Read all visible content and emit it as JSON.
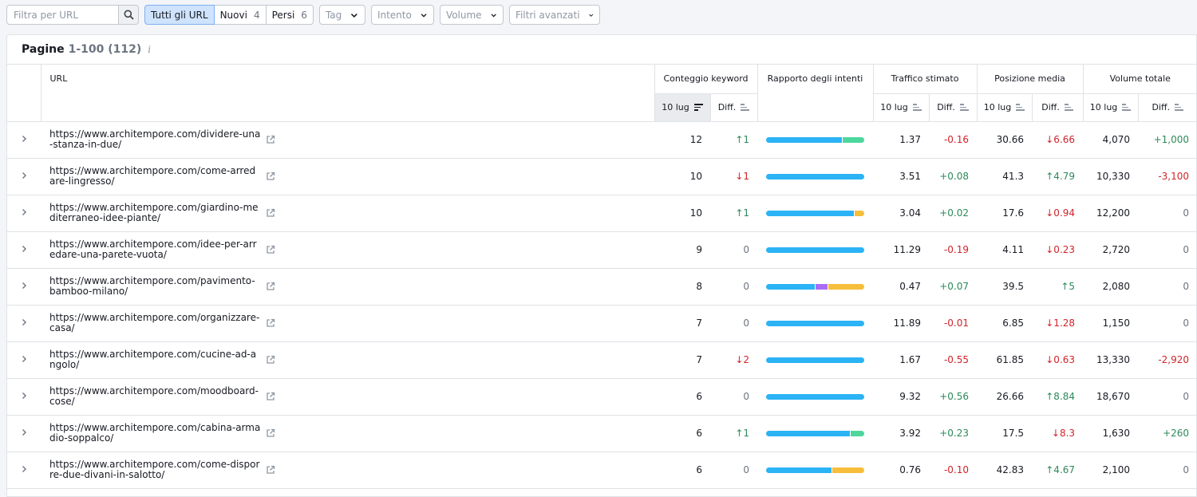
{
  "toolbar": {
    "search_placeholder": "Filtra per URL",
    "seg": [
      {
        "label": "Tutti gli URL",
        "count": ""
      },
      {
        "label": "Nuovi",
        "count": "4"
      },
      {
        "label": "Persi",
        "count": "6"
      }
    ],
    "dropdowns": [
      "Tag",
      "Intento",
      "Volume",
      "Filtri avanzati"
    ]
  },
  "panel": {
    "title": "Pagine",
    "range": "1-100 (112)",
    "info": "i"
  },
  "headers": {
    "url": "URL",
    "keyword_count": "Conteggio keyword",
    "intent_ratio": "Rapporto degli intenti",
    "traffic": "Traffico stimato",
    "position": "Posizione media",
    "volume": "Volume totale",
    "date": "10 lug",
    "diff": "Diff."
  },
  "colors": {
    "informational": "#2bb3f5",
    "navigational": "#a96df6",
    "commercial": "#f7be3b",
    "transactional": "#4dd69d"
  },
  "rows": [
    {
      "url": "https://www.architempore.com/dividere-una-stanza-in-due/",
      "kw": "12",
      "kw_diff": "↑1",
      "kw_dir": "pos",
      "intent": [
        {
          "c": "informational",
          "v": 78
        },
        {
          "c": "transactional",
          "v": 22
        }
      ],
      "traffic": "1.37",
      "traffic_diff": "-0.16",
      "traffic_dir": "neg",
      "pos": "30.66",
      "pos_diff": "↓6.66",
      "pos_dir": "neg",
      "vol": "4,070",
      "vol_diff": "+1,000",
      "vol_dir": "pos"
    },
    {
      "url": "https://www.architempore.com/come-arredare-lingresso/",
      "kw": "10",
      "kw_diff": "↓1",
      "kw_dir": "neg",
      "intent": [
        {
          "c": "informational",
          "v": 100
        }
      ],
      "traffic": "3.51",
      "traffic_diff": "+0.08",
      "traffic_dir": "pos",
      "pos": "41.3",
      "pos_diff": "↑4.79",
      "pos_dir": "pos",
      "vol": "10,330",
      "vol_diff": "-3,100",
      "vol_dir": "neg"
    },
    {
      "url": "https://www.architempore.com/giardino-mediterraneo-idee-piante/",
      "kw": "10",
      "kw_diff": "↑1",
      "kw_dir": "pos",
      "intent": [
        {
          "c": "informational",
          "v": 90
        },
        {
          "c": "commercial",
          "v": 10
        }
      ],
      "traffic": "3.04",
      "traffic_diff": "+0.02",
      "traffic_dir": "pos",
      "pos": "17.6",
      "pos_diff": "↓0.94",
      "pos_dir": "neg",
      "vol": "12,200",
      "vol_diff": "0",
      "vol_dir": "neu"
    },
    {
      "url": "https://www.architempore.com/idee-per-arredare-una-parete-vuota/",
      "kw": "9",
      "kw_diff": "0",
      "kw_dir": "neu",
      "intent": [
        {
          "c": "informational",
          "v": 100
        }
      ],
      "traffic": "11.29",
      "traffic_diff": "-0.19",
      "traffic_dir": "neg",
      "pos": "4.11",
      "pos_diff": "↓0.23",
      "pos_dir": "neg",
      "vol": "2,720",
      "vol_diff": "0",
      "vol_dir": "neu"
    },
    {
      "url": "https://www.architempore.com/pavimento-bamboo-milano/",
      "kw": "8",
      "kw_diff": "0",
      "kw_dir": "neu",
      "intent": [
        {
          "c": "informational",
          "v": 50
        },
        {
          "c": "navigational",
          "v": 13
        },
        {
          "c": "commercial",
          "v": 37
        }
      ],
      "traffic": "0.47",
      "traffic_diff": "+0.07",
      "traffic_dir": "pos",
      "pos": "39.5",
      "pos_diff": "↑5",
      "pos_dir": "pos",
      "vol": "2,080",
      "vol_diff": "0",
      "vol_dir": "neu"
    },
    {
      "url": "https://www.architempore.com/organizzare-casa/",
      "kw": "7",
      "kw_diff": "0",
      "kw_dir": "neu",
      "intent": [
        {
          "c": "informational",
          "v": 100
        }
      ],
      "traffic": "11.89",
      "traffic_diff": "-0.01",
      "traffic_dir": "neg",
      "pos": "6.85",
      "pos_diff": "↓1.28",
      "pos_dir": "neg",
      "vol": "1,150",
      "vol_diff": "0",
      "vol_dir": "neu"
    },
    {
      "url": "https://www.architempore.com/cucine-ad-angolo/",
      "kw": "7",
      "kw_diff": "↓2",
      "kw_dir": "neg",
      "intent": [
        {
          "c": "informational",
          "v": 100
        }
      ],
      "traffic": "1.67",
      "traffic_diff": "-0.55",
      "traffic_dir": "neg",
      "pos": "61.85",
      "pos_diff": "↓0.63",
      "pos_dir": "neg",
      "vol": "13,330",
      "vol_diff": "-2,920",
      "vol_dir": "neg"
    },
    {
      "url": "https://www.architempore.com/moodboard-cose/",
      "kw": "6",
      "kw_diff": "0",
      "kw_dir": "neu",
      "intent": [
        {
          "c": "informational",
          "v": 100
        }
      ],
      "traffic": "9.32",
      "traffic_diff": "+0.56",
      "traffic_dir": "pos",
      "pos": "26.66",
      "pos_diff": "↑8.84",
      "pos_dir": "pos",
      "vol": "18,670",
      "vol_diff": "0",
      "vol_dir": "neu"
    },
    {
      "url": "https://www.architempore.com/cabina-armadio-soppalco/",
      "kw": "6",
      "kw_diff": "↑1",
      "kw_dir": "pos",
      "intent": [
        {
          "c": "informational",
          "v": 86
        },
        {
          "c": "transactional",
          "v": 14
        }
      ],
      "traffic": "3.92",
      "traffic_diff": "+0.23",
      "traffic_dir": "pos",
      "pos": "17.5",
      "pos_diff": "↓8.3",
      "pos_dir": "neg",
      "vol": "1,630",
      "vol_diff": "+260",
      "vol_dir": "pos"
    },
    {
      "url": "https://www.architempore.com/come-disporre-due-divani-in-salotto/",
      "kw": "6",
      "kw_diff": "0",
      "kw_dir": "neu",
      "intent": [
        {
          "c": "informational",
          "v": 67
        },
        {
          "c": "commercial",
          "v": 33
        }
      ],
      "traffic": "0.76",
      "traffic_diff": "-0.10",
      "traffic_dir": "neg",
      "pos": "42.83",
      "pos_diff": "↑4.67",
      "pos_dir": "pos",
      "vol": "2,100",
      "vol_diff": "0",
      "vol_dir": "neu"
    }
  ]
}
